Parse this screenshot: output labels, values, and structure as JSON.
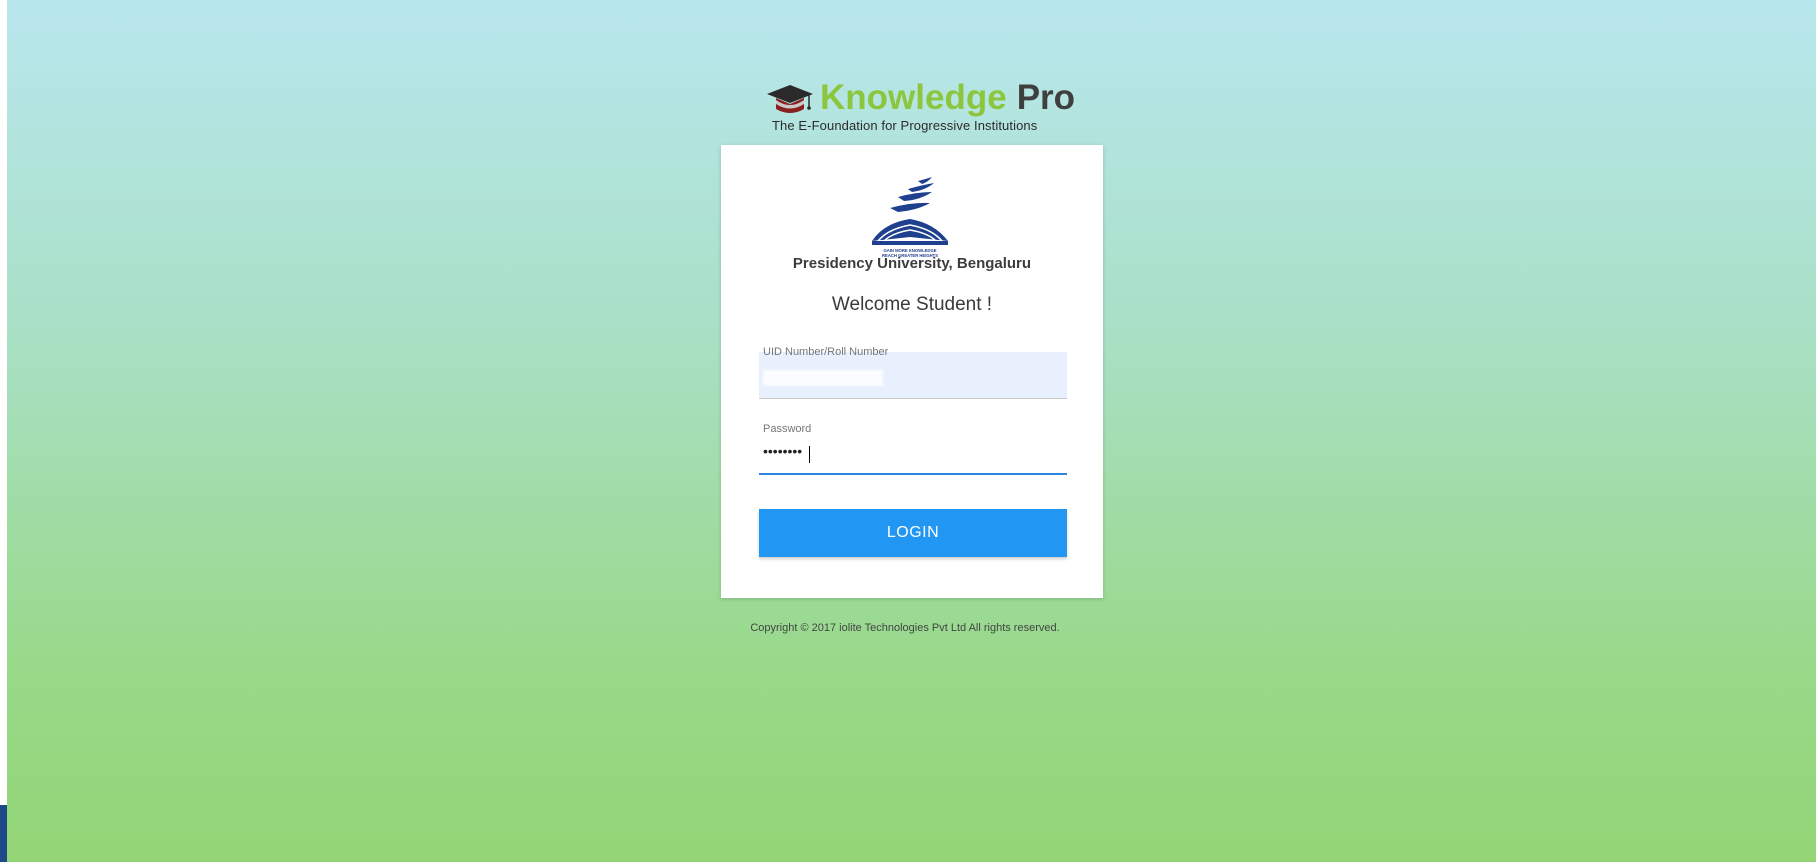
{
  "brand": {
    "title_part1": "Knowledge",
    "title_part2": "Pro",
    "tagline": "The E-Foundation for Progressive Institutions",
    "icon": "graduation-cap-icon",
    "colors": {
      "accent": "#8cc63e",
      "dark": "#3f3f3f"
    }
  },
  "login_card": {
    "university_logo": "university-logo",
    "university_logo_text": "GAIN MORE KNOWLEDGE REACH GREATER HEIGHTS",
    "university_name": "Presidency University, Bengaluru",
    "welcome": "Welcome Student !",
    "uid_field": {
      "label": "UID Number/Roll Number",
      "value": ""
    },
    "password_field": {
      "label": "Password",
      "value": "••••••••"
    },
    "login_button": "LOGIN",
    "button_color": "#2196f3"
  },
  "footer": {
    "copyright": "Copyright © 2017 iolite Technologies Pvt Ltd All rights reserved."
  }
}
